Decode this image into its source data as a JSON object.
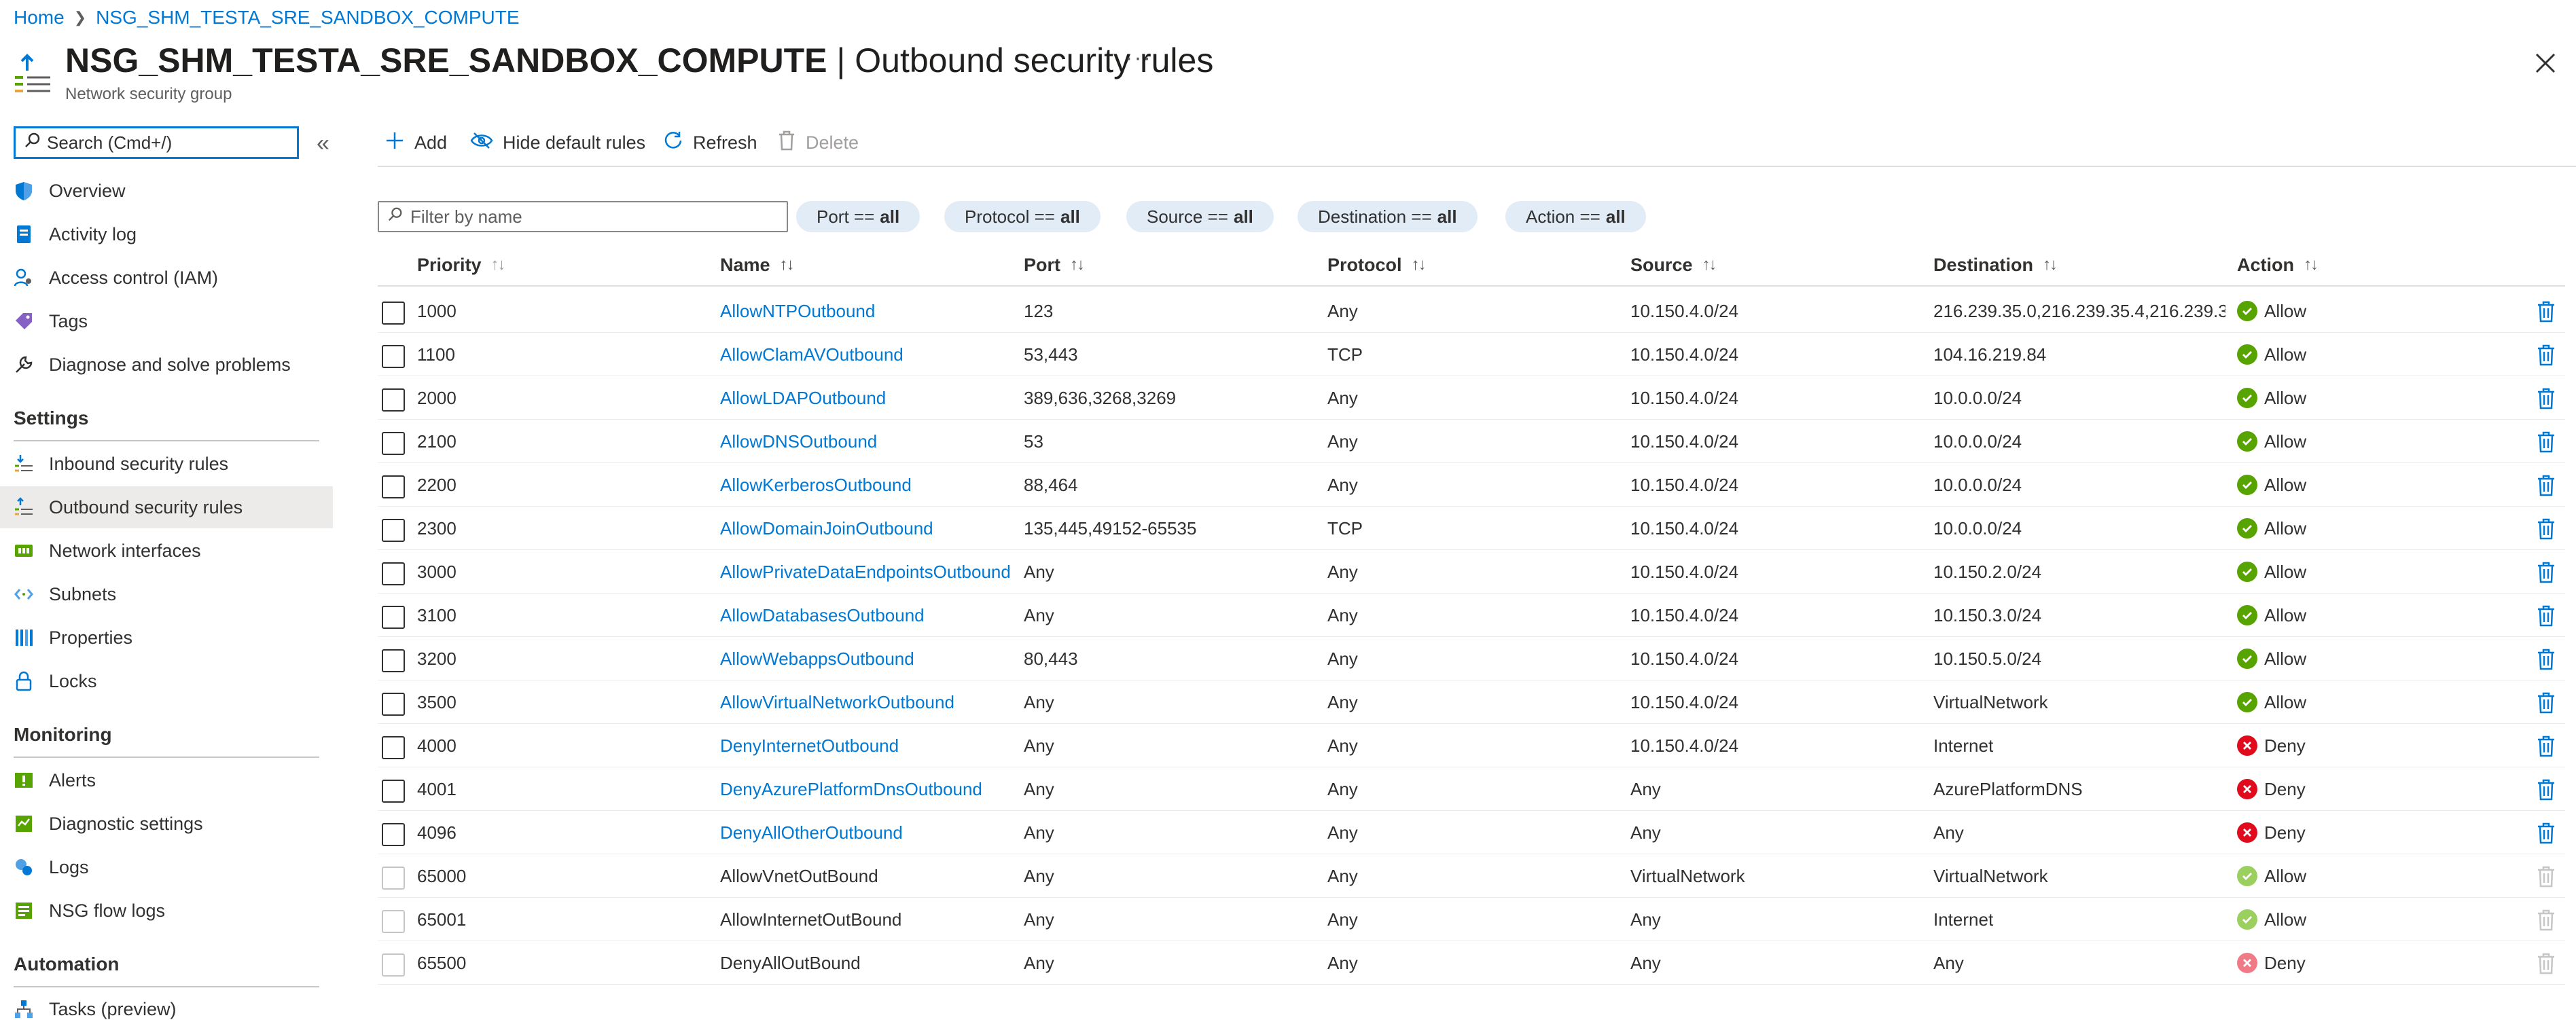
{
  "breadcrumb": {
    "home": "Home",
    "resource": "NSG_SHM_TESTA_SRE_SANDBOX_COMPUTE"
  },
  "header": {
    "title": "NSG_SHM_TESTA_SRE_SANDBOX_COMPUTE",
    "title_suffix": " | Outbound security rules",
    "subtitle": "Network security group",
    "more": "···"
  },
  "sidebar": {
    "search_placeholder": "Search (Cmd+/)",
    "collapse_glyph": "«",
    "items_top": [
      {
        "label": "Overview",
        "icon": "shield-icon"
      },
      {
        "label": "Activity log",
        "icon": "log-icon"
      },
      {
        "label": "Access control (IAM)",
        "icon": "people-icon"
      },
      {
        "label": "Tags",
        "icon": "tag-icon"
      },
      {
        "label": "Diagnose and solve problems",
        "icon": "wrench-icon"
      }
    ],
    "sections": [
      {
        "header": "Settings",
        "items": [
          {
            "label": "Inbound security rules",
            "icon": "inbound-icon"
          },
          {
            "label": "Outbound security rules",
            "icon": "outbound-icon",
            "active": true
          },
          {
            "label": "Network interfaces",
            "icon": "nic-icon"
          },
          {
            "label": "Subnets",
            "icon": "subnet-icon"
          },
          {
            "label": "Properties",
            "icon": "properties-icon"
          },
          {
            "label": "Locks",
            "icon": "lock-icon"
          }
        ]
      },
      {
        "header": "Monitoring",
        "items": [
          {
            "label": "Alerts",
            "icon": "alert-icon"
          },
          {
            "label": "Diagnostic settings",
            "icon": "diagnostic-icon"
          },
          {
            "label": "Logs",
            "icon": "logs-icon"
          },
          {
            "label": "NSG flow logs",
            "icon": "flowlog-icon"
          }
        ]
      },
      {
        "header": "Automation",
        "items": [
          {
            "label": "Tasks (preview)",
            "icon": "tasks-icon"
          }
        ]
      }
    ]
  },
  "toolbar": {
    "add": "Add",
    "hide_default": "Hide default rules",
    "refresh": "Refresh",
    "delete": "Delete"
  },
  "filters": {
    "placeholder": "Filter by name",
    "pills": [
      {
        "prefix": "Port ==",
        "value": "all"
      },
      {
        "prefix": "Protocol ==",
        "value": "all"
      },
      {
        "prefix": "Source ==",
        "value": "all"
      },
      {
        "prefix": "Destination ==",
        "value": "all"
      },
      {
        "prefix": "Action ==",
        "value": "all"
      }
    ]
  },
  "table": {
    "columns": [
      "Priority",
      "Name",
      "Port",
      "Protocol",
      "Source",
      "Destination",
      "Action"
    ],
    "rows": [
      {
        "priority": "1000",
        "name": "AllowNTPOutbound",
        "port": "123",
        "protocol": "Any",
        "source": "10.150.4.0/24",
        "destination": "216.239.35.0,216.239.35.4,216.239.3...",
        "action": "Allow",
        "default": false
      },
      {
        "priority": "1100",
        "name": "AllowClamAVOutbound",
        "port": "53,443",
        "protocol": "TCP",
        "source": "10.150.4.0/24",
        "destination": "104.16.219.84",
        "action": "Allow",
        "default": false
      },
      {
        "priority": "2000",
        "name": "AllowLDAPOutbound",
        "port": "389,636,3268,3269",
        "protocol": "Any",
        "source": "10.150.4.0/24",
        "destination": "10.0.0.0/24",
        "action": "Allow",
        "default": false
      },
      {
        "priority": "2100",
        "name": "AllowDNSOutbound",
        "port": "53",
        "protocol": "Any",
        "source": "10.150.4.0/24",
        "destination": "10.0.0.0/24",
        "action": "Allow",
        "default": false
      },
      {
        "priority": "2200",
        "name": "AllowKerberosOutbound",
        "port": "88,464",
        "protocol": "Any",
        "source": "10.150.4.0/24",
        "destination": "10.0.0.0/24",
        "action": "Allow",
        "default": false
      },
      {
        "priority": "2300",
        "name": "AllowDomainJoinOutbound",
        "port": "135,445,49152-65535",
        "protocol": "TCP",
        "source": "10.150.4.0/24",
        "destination": "10.0.0.0/24",
        "action": "Allow",
        "default": false
      },
      {
        "priority": "3000",
        "name": "AllowPrivateDataEndpointsOutbound",
        "port": "Any",
        "protocol": "Any",
        "source": "10.150.4.0/24",
        "destination": "10.150.2.0/24",
        "action": "Allow",
        "default": false
      },
      {
        "priority": "3100",
        "name": "AllowDatabasesOutbound",
        "port": "Any",
        "protocol": "Any",
        "source": "10.150.4.0/24",
        "destination": "10.150.3.0/24",
        "action": "Allow",
        "default": false
      },
      {
        "priority": "3200",
        "name": "AllowWebappsOutbound",
        "port": "80,443",
        "protocol": "Any",
        "source": "10.150.4.0/24",
        "destination": "10.150.5.0/24",
        "action": "Allow",
        "default": false
      },
      {
        "priority": "3500",
        "name": "AllowVirtualNetworkOutbound",
        "port": "Any",
        "protocol": "Any",
        "source": "10.150.4.0/24",
        "destination": "VirtualNetwork",
        "action": "Allow",
        "default": false
      },
      {
        "priority": "4000",
        "name": "DenyInternetOutbound",
        "port": "Any",
        "protocol": "Any",
        "source": "10.150.4.0/24",
        "destination": "Internet",
        "action": "Deny",
        "default": false
      },
      {
        "priority": "4001",
        "name": "DenyAzurePlatformDnsOutbound",
        "port": "Any",
        "protocol": "Any",
        "source": "Any",
        "destination": "AzurePlatformDNS",
        "action": "Deny",
        "default": false
      },
      {
        "priority": "4096",
        "name": "DenyAllOtherOutbound",
        "port": "Any",
        "protocol": "Any",
        "source": "Any",
        "destination": "Any",
        "action": "Deny",
        "default": false
      },
      {
        "priority": "65000",
        "name": "AllowVnetOutBound",
        "port": "Any",
        "protocol": "Any",
        "source": "VirtualNetwork",
        "destination": "VirtualNetwork",
        "action": "Allow",
        "default": true
      },
      {
        "priority": "65001",
        "name": "AllowInternetOutBound",
        "port": "Any",
        "protocol": "Any",
        "source": "Any",
        "destination": "Internet",
        "action": "Allow",
        "default": true
      },
      {
        "priority": "65500",
        "name": "DenyAllOutBound",
        "port": "Any",
        "protocol": "Any",
        "source": "Any",
        "destination": "Any",
        "action": "Deny",
        "default": true
      }
    ]
  },
  "colors": {
    "accent": "#0078d4",
    "allow": "#57a300",
    "deny": "#e00b1c",
    "allow_faint": "#9bd05f",
    "deny_faint": "#f07b86"
  }
}
